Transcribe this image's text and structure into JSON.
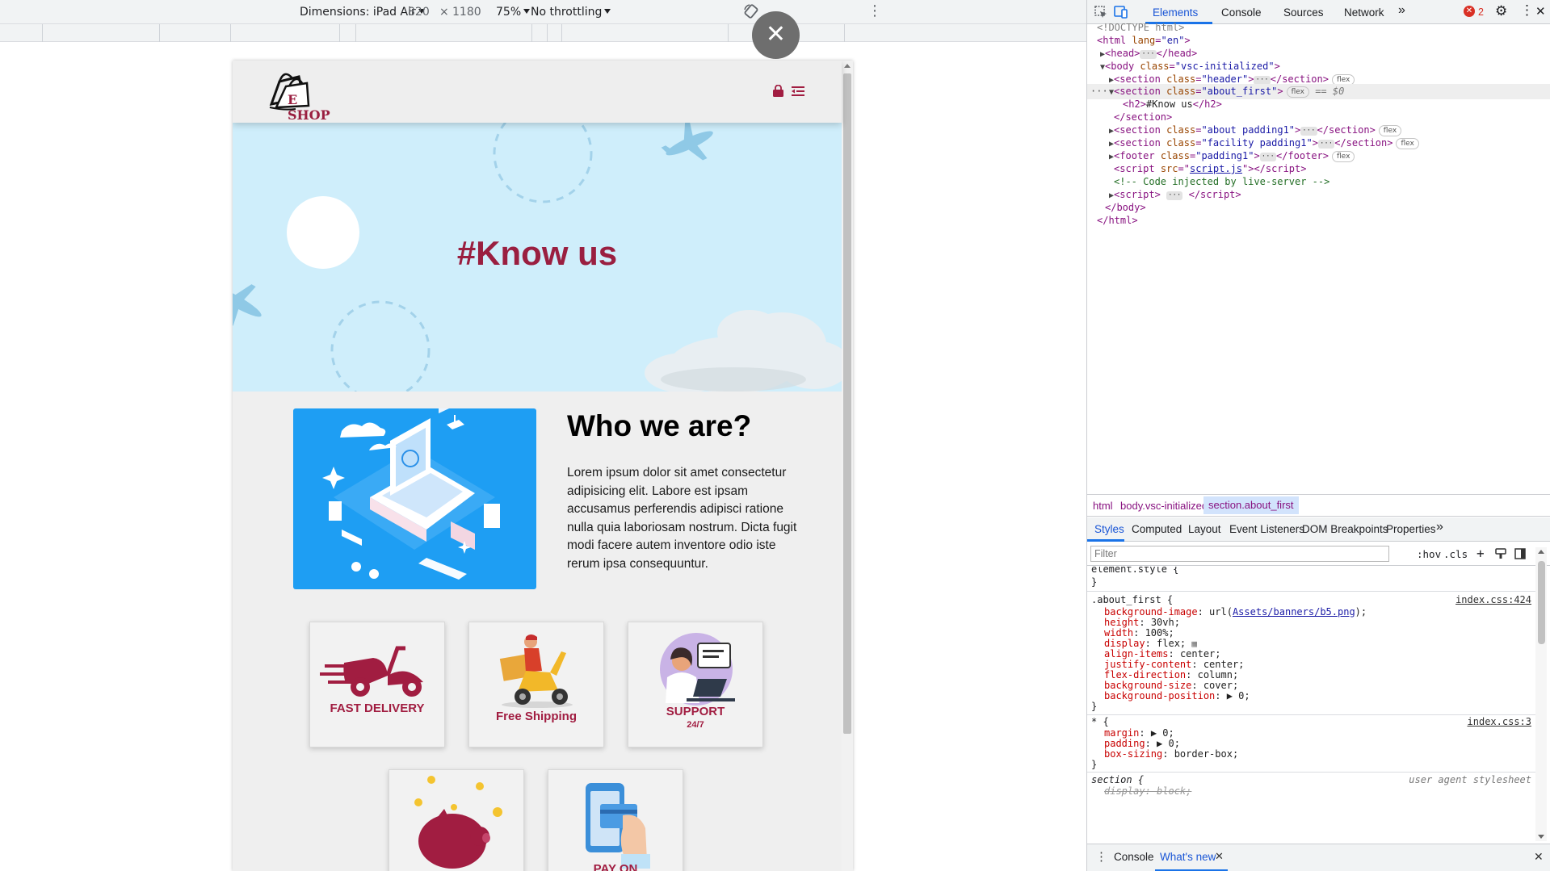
{
  "device_toolbar": {
    "dimensions_label": "Dimensions: iPad Air",
    "width": "820",
    "times": "×",
    "height": "1180",
    "zoom": "75%",
    "throttling": "No throttling"
  },
  "site": {
    "logo_text": "E SHOP",
    "hero_title": "#Know us",
    "who_heading": "Who we are?",
    "who_text": "Lorem ipsum dolor sit amet consectetur adipisicing elit. Labore est ipsam accusamus perferendis adipisci ratione nulla quia laboriosam nostrum. Dicta fugit modi facere autem inventore odio iste rerum ipsa consequuntur.",
    "cards": [
      {
        "label": "FAST DELIVERY"
      },
      {
        "label": "Free Shipping"
      },
      {
        "label": "SUPPORT",
        "sub": "24/7"
      },
      {
        "label": ""
      },
      {
        "label": "PAY ON"
      }
    ]
  },
  "devtools": {
    "tabs": [
      "Elements",
      "Console",
      "Sources",
      "Network"
    ],
    "error_count": "2",
    "dom": [
      "<!DOCTYPE html>"
    ],
    "dom_texts": {
      "doctype": "<!DOCTYPE html>",
      "html_open": "html",
      "lang_attr": "lang",
      "lang_val": "\"en\"",
      "head": "head",
      "body": "body",
      "class_attr": "class",
      "body_class": "\"vsc-initialized\"",
      "section": "section",
      "header_class": "\"header\"",
      "about_first_class": "\"about_first\"",
      "dollar0": "== $0",
      "h2_text": "#Know us",
      "h2": "h2",
      "about_class": "\"about padding1\"",
      "facility_class": "\"facility padding1\"",
      "footer": "footer",
      "footer_class": "\"padding1\"",
      "script": "script",
      "src_attr": "src",
      "script_src": "script.js",
      "comment": "<!-- Code injected by live-server -->",
      "flex": "flex"
    },
    "breadcrumbs": [
      "html",
      "body.vsc-initialized",
      "section.about_first"
    ],
    "sub_tabs": [
      "Styles",
      "Computed",
      "Layout",
      "Event Listeners",
      "DOM Breakpoints",
      "Properties"
    ],
    "filter_placeholder": "Filter",
    "hov": ":hov",
    "cls": ".cls",
    "styles": {
      "element_style": "element.style {",
      "close": "}",
      "rule1_selector": ".about_first {",
      "rule1_source": "index.css:424",
      "rule1_props": [
        {
          "name": "background-image",
          "value": "url(",
          "link": "Assets/banners/b5.png",
          "tail": ");"
        },
        {
          "name": "height",
          "value": "30vh;"
        },
        {
          "name": "width",
          "value": "100%;"
        },
        {
          "name": "display",
          "value": "flex;"
        },
        {
          "name": "align-items",
          "value": "center;"
        },
        {
          "name": "justify-content",
          "value": "center;"
        },
        {
          "name": "flex-direction",
          "value": "column;"
        },
        {
          "name": "background-size",
          "value": "cover;"
        },
        {
          "name": "background-position",
          "value": "▶ 0;"
        }
      ],
      "rule2_selector": "* {",
      "rule2_source": "index.css:3",
      "rule2_props": [
        {
          "name": "margin",
          "value": "▶ 0;"
        },
        {
          "name": "padding",
          "value": "▶ 0;"
        },
        {
          "name": "box-sizing",
          "value": "border-box;"
        }
      ],
      "rule3_selector": "section {",
      "rule3_source": "user agent stylesheet",
      "rule3_prop": "display: block;"
    },
    "drawer_tabs": [
      "Console",
      "What's new"
    ]
  }
}
